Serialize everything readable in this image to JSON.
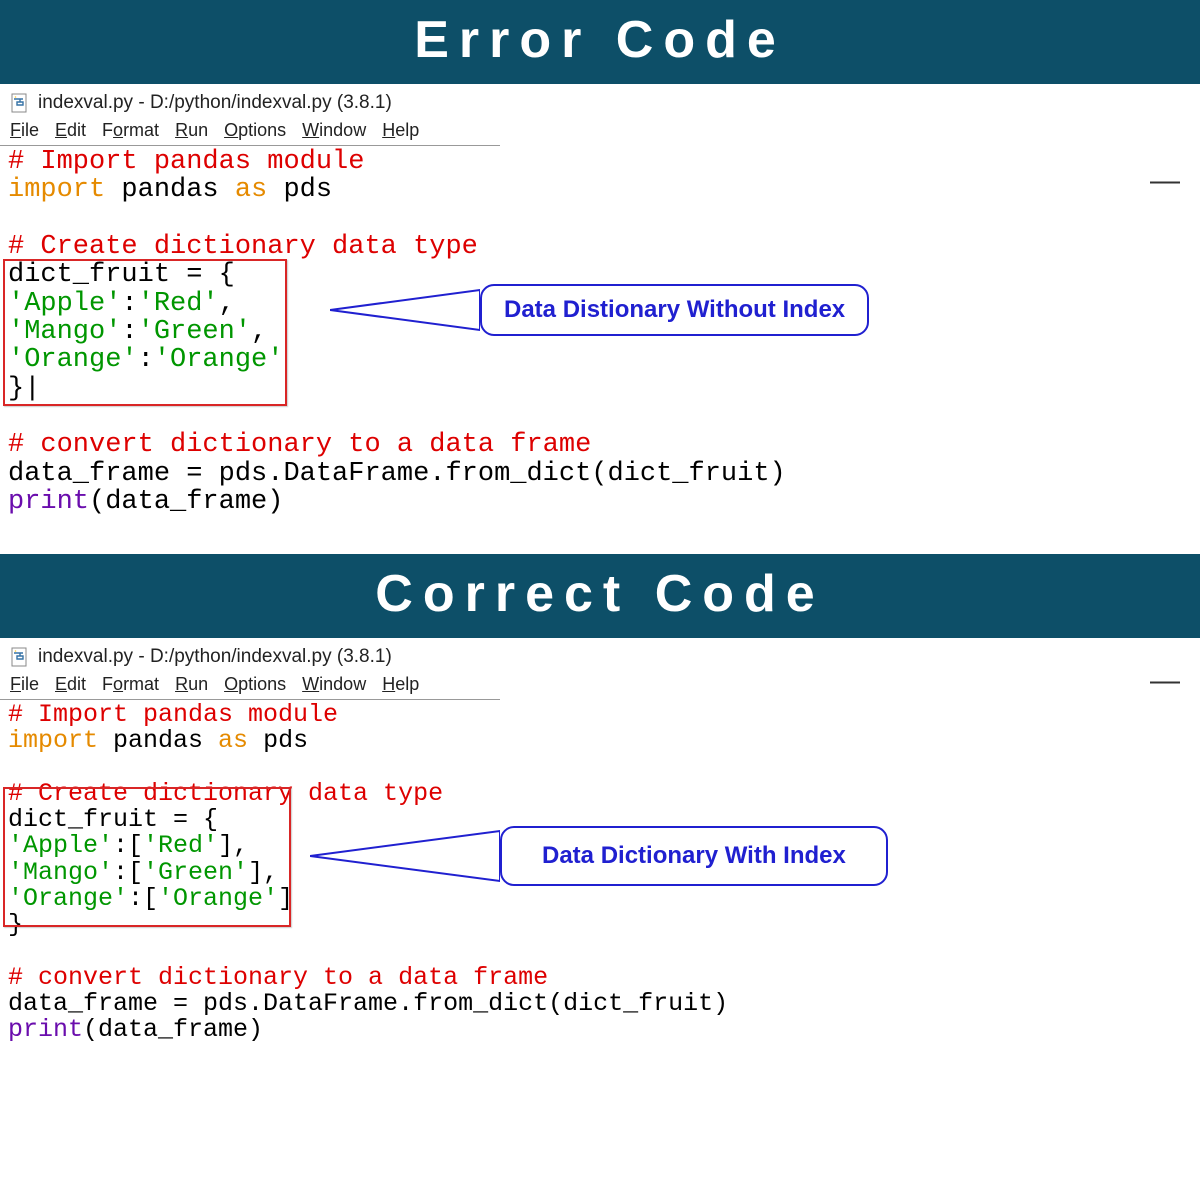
{
  "banners": {
    "error": "Error Code",
    "correct": "Correct Code"
  },
  "window": {
    "title": "indexval.py - D:/python/indexval.py (3.8.1)"
  },
  "menu": {
    "file": "File",
    "edit": "Edit",
    "format": "Format",
    "run": "Run",
    "options": "Options",
    "window": "Window",
    "help": "Help"
  },
  "code1": {
    "c1": "# Import pandas module",
    "kw_import": "import",
    "txt_pandas": " pandas ",
    "kw_as": "as",
    "txt_pds": " pds",
    "c2": "# Create dictionary data type",
    "txt_dict": "dict_fruit = {",
    "s_apple": "'Apple'",
    "s_red": "'Red'",
    "s_mango": "'Mango'",
    "s_green": "'Green'",
    "s_orange": "'Orange'",
    "s_orange2": "'Orange'",
    "txt_close": "}|",
    "c3": "# convert dictionary to a data frame",
    "txt_df": "data_frame = pds.DataFrame.from_dict(dict_fruit)",
    "bi_print": "print",
    "txt_print": "(data_frame)"
  },
  "code2": {
    "c1": "# Import pandas module",
    "kw_import": "import",
    "txt_pandas": " pandas ",
    "kw_as": "as",
    "txt_pds": " pds",
    "c2": "# Create dictionary data type",
    "txt_dict": "dict_fruit = {",
    "s_apple": "'Apple'",
    "s_red": "'Red'",
    "s_mango": "'Mango'",
    "s_green": "'Green'",
    "s_orange": "'Orange'",
    "s_orange2": "'Orange'",
    "txt_close": "}",
    "c3": "# convert dictionary to a data frame",
    "txt_df": "data_frame = pds.DataFrame.from_dict(dict_fruit)",
    "bi_print": "print",
    "txt_print": "(data_frame)"
  },
  "callouts": {
    "without": "Data Distionary Without Index",
    "with": "Data Dictionary With Index"
  }
}
